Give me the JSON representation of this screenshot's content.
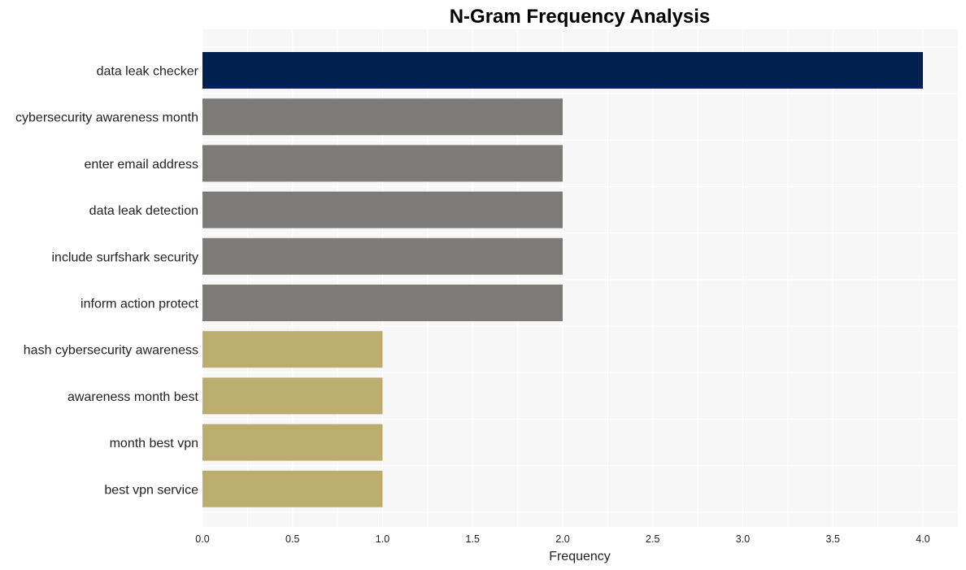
{
  "chart_data": {
    "type": "bar",
    "orientation": "horizontal",
    "title": "N-Gram Frequency Analysis",
    "xlabel": "Frequency",
    "ylabel": "",
    "xlim": [
      0,
      4.2
    ],
    "xticks": [
      0.0,
      0.5,
      1.0,
      1.5,
      2.0,
      2.5,
      3.0,
      3.5,
      4.0
    ],
    "xtick_labels": [
      "0.0",
      "0.5",
      "1.0",
      "1.5",
      "2.0",
      "2.5",
      "3.0",
      "3.5",
      "4.0"
    ],
    "grid": true,
    "legend": "none",
    "categories": [
      "data leak checker",
      "cybersecurity awareness month",
      "enter email address",
      "data leak detection",
      "include surfshark security",
      "inform action protect",
      "hash cybersecurity awareness",
      "awareness month best",
      "month best vpn",
      "best vpn service"
    ],
    "values": [
      4,
      2,
      2,
      2,
      2,
      2,
      1,
      1,
      1,
      1
    ],
    "colors": [
      "#00204f",
      "#7c7b77",
      "#7c7b77",
      "#7c7b77",
      "#7c7b77",
      "#7c7b77",
      "#bcad6f",
      "#bcad6f",
      "#bcad6f",
      "#bcad6f"
    ],
    "background_color": "#f7f7f7",
    "grid_color": "#ffffff"
  }
}
